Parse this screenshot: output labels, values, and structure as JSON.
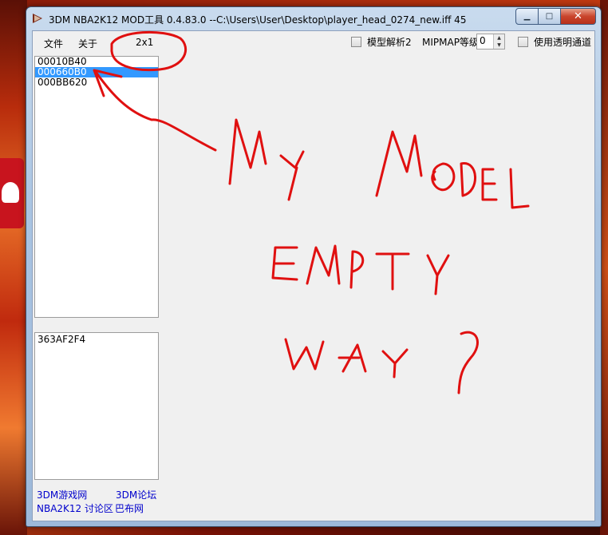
{
  "window": {
    "title": "3DM NBA2K12 MOD工具 0.4.83.0 --C:\\Users\\User\\Desktop\\player_head_0274_new.iff  45",
    "minimize_glyph": "▁",
    "maximize_glyph": "□",
    "close_glyph": "✕"
  },
  "menu": {
    "file": "文件",
    "about": "关于",
    "grid": "2x1"
  },
  "options": {
    "model_parse_label": "模型解析2",
    "model_parse_checked": false,
    "mipmap_label": "MIPMAP等级",
    "mipmap_value": "0",
    "transparent_label": "使用透明通道",
    "transparent_checked": false
  },
  "list1": {
    "items": [
      "00010B40",
      "000660B0",
      "000BB620"
    ],
    "selected_index": 1
  },
  "list2": {
    "items": [
      "363AF2F4"
    ]
  },
  "links": {
    "site": "3DM游戏网",
    "forum": "3DM论坛",
    "nba_forum": "NBA2K12 讨论区",
    "babu": "巴布网"
  },
  "colors": {
    "selection": "#3399ff",
    "link": "#0000cc",
    "annotation": "#e01010"
  }
}
